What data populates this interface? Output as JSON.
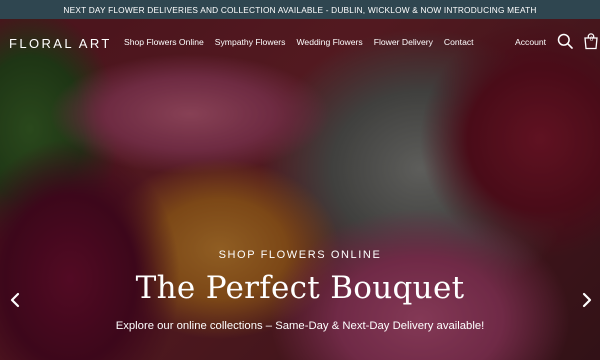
{
  "announcement": "NEXT DAY FLOWER DELIVERIES AND COLLECTION AVAILABLE - DUBLIN, WICKLOW & NOW INTRODUCING MEATH",
  "header": {
    "logo": "FLORAL ART",
    "menu": [
      "Shop Flowers Online",
      "Sympathy Flowers",
      "Wedding Flowers",
      "Flower Delivery",
      "Contact"
    ],
    "account": "Account",
    "cart_count": "0"
  },
  "hero": {
    "kicker": "SHOP FLOWERS ONLINE",
    "headline": "The Perfect Bouquet",
    "subtext": "Explore our online collections – Same-Day & Next-Day Delivery available!"
  },
  "icons": {
    "search": "search-icon",
    "cart": "shopping-bag-icon",
    "prev": "chevron-left-icon",
    "next": "chevron-right-icon"
  }
}
